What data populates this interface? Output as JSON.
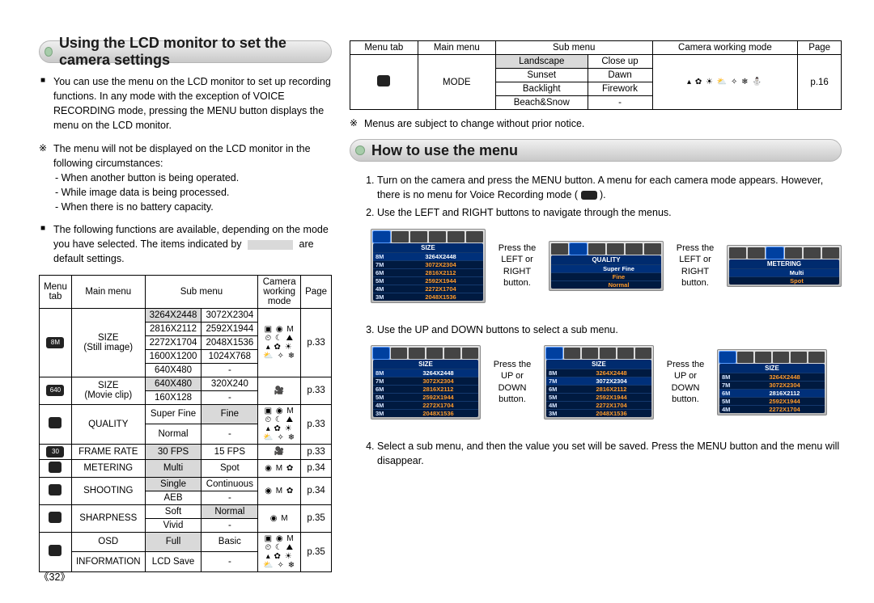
{
  "page_number": "《32》",
  "heading_left": "Using the LCD monitor to set the camera settings",
  "heading_right": "How to use the menu",
  "intro": {
    "b1": "You can use the menu on the LCD monitor to set up recording functions. In any mode with the exception of VOICE RECORDING mode, pressing the MENU button displays the menu on the LCD monitor.",
    "s1": "The menu will not be displayed on the LCD monitor in the following circumstances:",
    "s1a": "- When another button is being operated.",
    "s1b": "- While image data is being processed.",
    "s1c": "- When there is no battery capacity.",
    "b2a": "The following functions are available, depending on the mode you have selected. The items indicated by",
    "b2b": "are default settings."
  },
  "table_headers": {
    "menu_tab": "Menu tab",
    "main_menu": "Main menu",
    "sub_menu": "Sub menu",
    "mode": "Camera working mode",
    "page": "Page"
  },
  "table1": {
    "rows": [
      {
        "icon": "8M",
        "main": "SIZE\n(Still image)",
        "sub": [
          [
            "3264X2448",
            "3072X2304"
          ],
          [
            "2816X2112",
            "2592X1944"
          ],
          [
            "2272X1704",
            "2048X1536"
          ],
          [
            "1600X1200",
            "1024X768"
          ],
          [
            "640X480",
            "-"
          ]
        ],
        "def": [
          0,
          0
        ],
        "page": "p.33"
      },
      {
        "icon": "640",
        "main": "SIZE\n(Movie clip)",
        "sub": [
          [
            "640X480",
            "320X240"
          ],
          [
            "160X128",
            "-"
          ]
        ],
        "def": [
          0,
          0
        ],
        "page": "p.33"
      },
      {
        "icon": "⊞",
        "main": "QUALITY",
        "sub": [
          [
            "Super Fine",
            "Fine"
          ],
          [
            "Normal",
            "-"
          ]
        ],
        "def": [
          0,
          1
        ],
        "page": "p.33"
      },
      {
        "icon": "30",
        "main": "FRAME RATE",
        "sub": [
          [
            "30 FPS",
            "15 FPS"
          ]
        ],
        "def": [
          0,
          0
        ],
        "page": "p.33"
      },
      {
        "icon": "▣",
        "main": "METERING",
        "sub": [
          [
            "Multi",
            "Spot"
          ]
        ],
        "def": [
          0,
          0
        ],
        "page": "p.34"
      },
      {
        "icon": "▢",
        "main": "SHOOTING",
        "sub": [
          [
            "Single",
            "Continuous"
          ],
          [
            "AEB",
            "-"
          ]
        ],
        "def": [
          0,
          0
        ],
        "page": "p.34"
      },
      {
        "icon": "◪",
        "main": "SHARPNESS",
        "sub": [
          [
            "Soft",
            "Normal"
          ],
          [
            "Vivid",
            "-"
          ]
        ],
        "def": [
          0,
          1
        ],
        "page": "p.35"
      },
      {
        "icon": "⎚",
        "main2": "OSD\nINFORMATION",
        "sub": [
          [
            "Full",
            "Basic"
          ],
          [
            "LCD Save",
            "-"
          ]
        ],
        "def": [
          0,
          0
        ],
        "page": "p.35"
      }
    ],
    "mode_icons_full": "▣ ◉ M ⏲ ☾ ⛰ ▴ ✿ ☀ ⛅ ✧ ❄",
    "mode_movie": "🎥",
    "mode_pm": "◉ M ✿",
    "mode_pm2": "◉ M"
  },
  "table2": {
    "main": "MODE",
    "rows": [
      [
        "Landscape",
        "Close up"
      ],
      [
        "Sunset",
        "Dawn"
      ],
      [
        "Backlight",
        "Firework"
      ],
      [
        "Beach&Snow",
        "-"
      ]
    ],
    "def": [
      0,
      0
    ],
    "mode_icons": "▴ ✿ ☀ ⛅ ✧ ❄ ⛄",
    "page": "p.16"
  },
  "note_right": "Menus are subject to change without prior notice.",
  "steps": {
    "s1": "Turn on the camera and press the MENU button. A menu for each camera mode appears. However, there is no menu for Voice Recording mode (",
    "s1_end": ").",
    "s2": "Use the LEFT and RIGHT buttons to navigate through the menus.",
    "hint_lr": "Press the LEFT or RIGHT button.",
    "s3": "Use the UP and DOWN buttons to select a sub menu.",
    "hint_ud": "Press the UP or DOWN button.",
    "s4": "Select a sub menu, and then the value you set will be saved. Press the MENU button and the menu will disappear."
  },
  "lcd": {
    "size": {
      "label": "SIZE",
      "rows": [
        [
          "8M",
          "3264X2448"
        ],
        [
          "7M",
          "3072X2304"
        ],
        [
          "6M",
          "2816X2112"
        ],
        [
          "5M",
          "2592X1944"
        ],
        [
          "4M",
          "2272X1704"
        ],
        [
          "3M",
          "2048X1536"
        ]
      ]
    },
    "quality": {
      "label": "QUALITY",
      "rows": [
        [
          "",
          "Super Fine"
        ],
        [
          "",
          "Fine"
        ],
        [
          "",
          "Normal"
        ]
      ]
    },
    "metering": {
      "label": "METERING",
      "rows": [
        [
          "",
          "Multi"
        ],
        [
          "",
          "Spot"
        ]
      ]
    },
    "size_a": {
      "label": "SIZE",
      "rows": [
        [
          "8M",
          "3264X2448"
        ],
        [
          "7M",
          "3072X2304"
        ],
        [
          "6M",
          "2816X2112"
        ],
        [
          "5M",
          "2592X1944"
        ],
        [
          "4M",
          "2272X1704"
        ],
        [
          "3M",
          "2048X1536"
        ]
      ]
    },
    "size_b": {
      "label": "SIZE",
      "rows": [
        [
          "8M",
          "3264X2448"
        ],
        [
          "7M",
          "3072X2304"
        ],
        [
          "6M",
          "2816X2112"
        ],
        [
          "5M",
          "2592X1944"
        ],
        [
          "4M",
          "2272X1704"
        ],
        [
          "3M",
          "2048X1536"
        ]
      ]
    },
    "size_c": {
      "label": "SIZE",
      "rows": [
        [
          "8M",
          "3264X2448"
        ],
        [
          "7M",
          "3072X2304"
        ],
        [
          "6M",
          "2816X2112"
        ],
        [
          "5M",
          "2592X1944"
        ],
        [
          "4M",
          "2272X1704"
        ]
      ]
    }
  }
}
